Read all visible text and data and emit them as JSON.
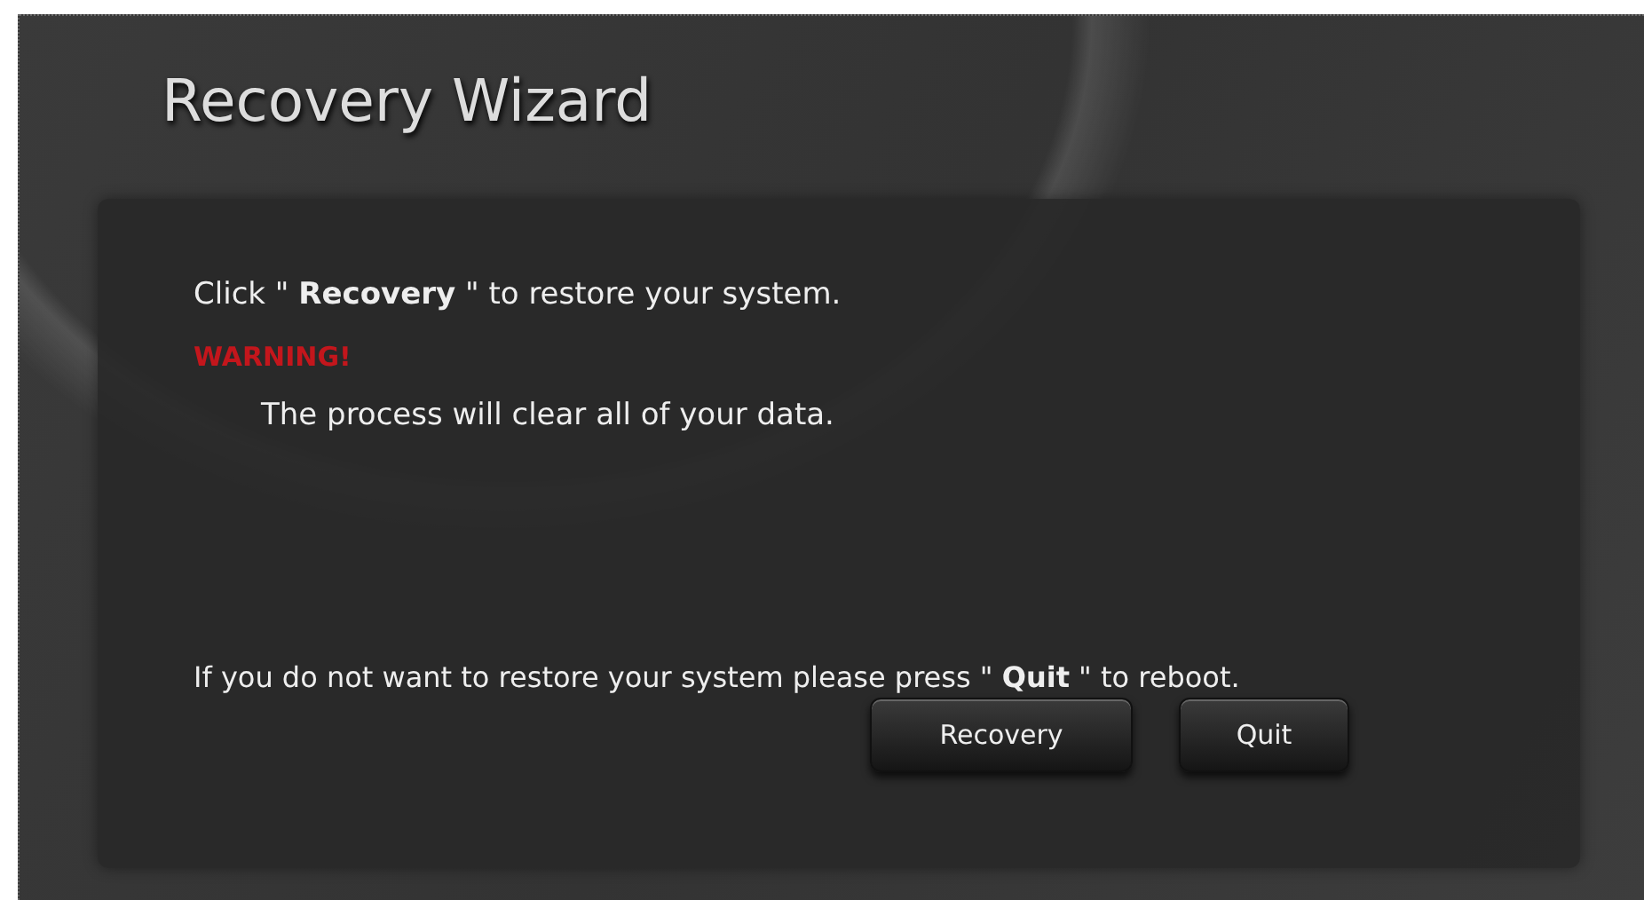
{
  "window": {
    "title": "Recovery Wizard"
  },
  "instruction": "Click \" **Recovery** \" to restore your system.",
  "warning": {
    "label": "WARNING!",
    "message": "The process will clear all of your data."
  },
  "quit_note": "If you do not want to restore your system please press \" **Quit** \" to reboot.",
  "buttons": [
    {
      "label": "Recovery"
    },
    {
      "label": "Quit"
    }
  ]
}
